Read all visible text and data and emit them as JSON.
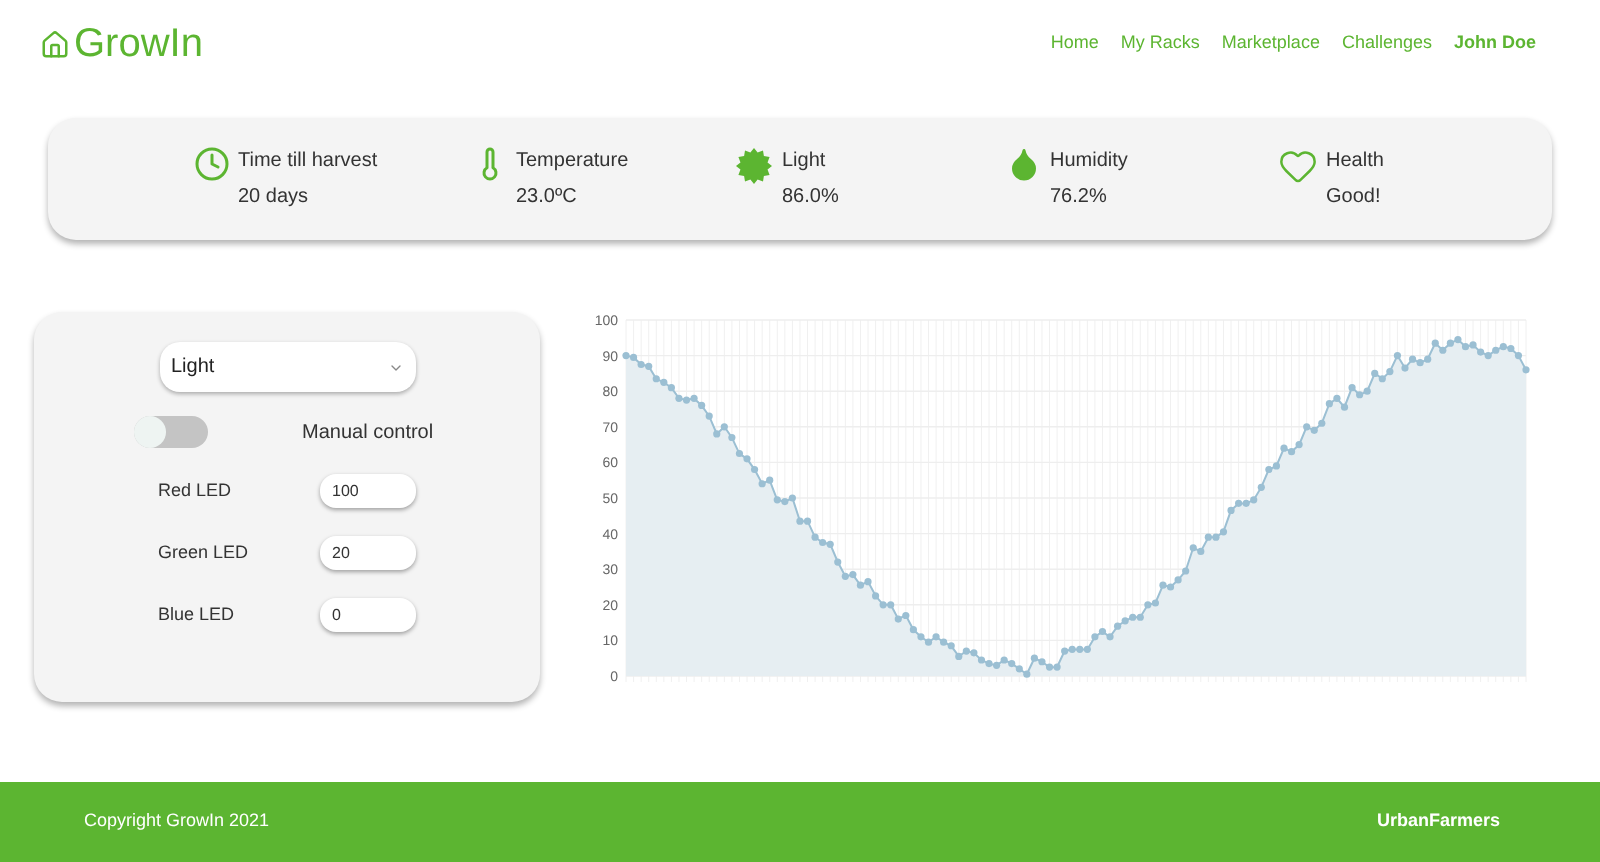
{
  "logo": "GrowIn",
  "nav": [
    {
      "label": "Home",
      "kind": "link"
    },
    {
      "label": "My Racks",
      "kind": "link"
    },
    {
      "label": "Marketplace",
      "kind": "link"
    },
    {
      "label": "Challenges",
      "kind": "link"
    },
    {
      "label": "John Doe",
      "kind": "user"
    }
  ],
  "stats": [
    {
      "kind": "clock",
      "label": "Time till harvest",
      "value": "20 days"
    },
    {
      "kind": "thermometer",
      "label": "Temperature",
      "value": "23.0ºC"
    },
    {
      "kind": "light",
      "label": "Light",
      "value": "86.0%"
    },
    {
      "kind": "humidity",
      "label": "Humidity",
      "value": "76.2%"
    },
    {
      "kind": "health",
      "label": "Health",
      "value": "Good!"
    }
  ],
  "controls": {
    "select": "Light",
    "manual_control": {
      "label": "Manual control",
      "on": false
    },
    "leds": [
      {
        "label": "Red LED",
        "value": "100"
      },
      {
        "label": "Green LED",
        "value": "20"
      },
      {
        "label": "Blue LED",
        "value": "0"
      }
    ]
  },
  "chart_data": {
    "type": "area",
    "grid": true,
    "ylim": [
      0,
      100
    ],
    "yticks": [
      0,
      10,
      20,
      30,
      40,
      50,
      60,
      70,
      80,
      90,
      100
    ],
    "values": [
      90,
      89.5,
      87.5,
      87,
      83.5,
      82.5,
      81,
      78,
      77.5,
      78,
      76,
      73,
      68,
      70,
      67,
      62.5,
      61,
      58,
      54,
      55,
      49.5,
      49,
      50,
      43.5,
      43.5,
      39,
      37.5,
      37,
      32,
      28,
      28.5,
      25.5,
      26.5,
      22.5,
      20,
      20,
      16,
      17,
      13,
      11,
      9.5,
      11,
      9.5,
      8.5,
      5.5,
      7,
      6.5,
      4.5,
      3.5,
      3,
      4.5,
      3.5,
      2,
      0.5,
      5,
      4,
      2.5,
      2.5,
      7,
      7.5,
      7.5,
      7.5,
      11,
      12.5,
      11,
      14,
      15.5,
      16.5,
      16.5,
      20,
      20.5,
      25.5,
      25,
      27,
      29.5,
      36,
      35,
      39,
      39,
      40.5,
      46.5,
      48.5,
      48.5,
      49.5,
      53,
      58,
      59,
      64,
      63,
      65,
      70,
      69,
      71,
      76.5,
      78,
      75.5,
      81,
      79,
      80,
      85,
      83.5,
      85.5,
      90,
      86.5,
      89,
      88,
      89,
      93.5,
      91.5,
      93.5,
      94.5,
      92.5,
      93,
      91,
      90,
      91.5,
      92.5,
      92,
      90,
      86
    ]
  },
  "footer": {
    "copyright": "Copyright GrowIn 2021",
    "brand": "UrbanFarmers"
  }
}
